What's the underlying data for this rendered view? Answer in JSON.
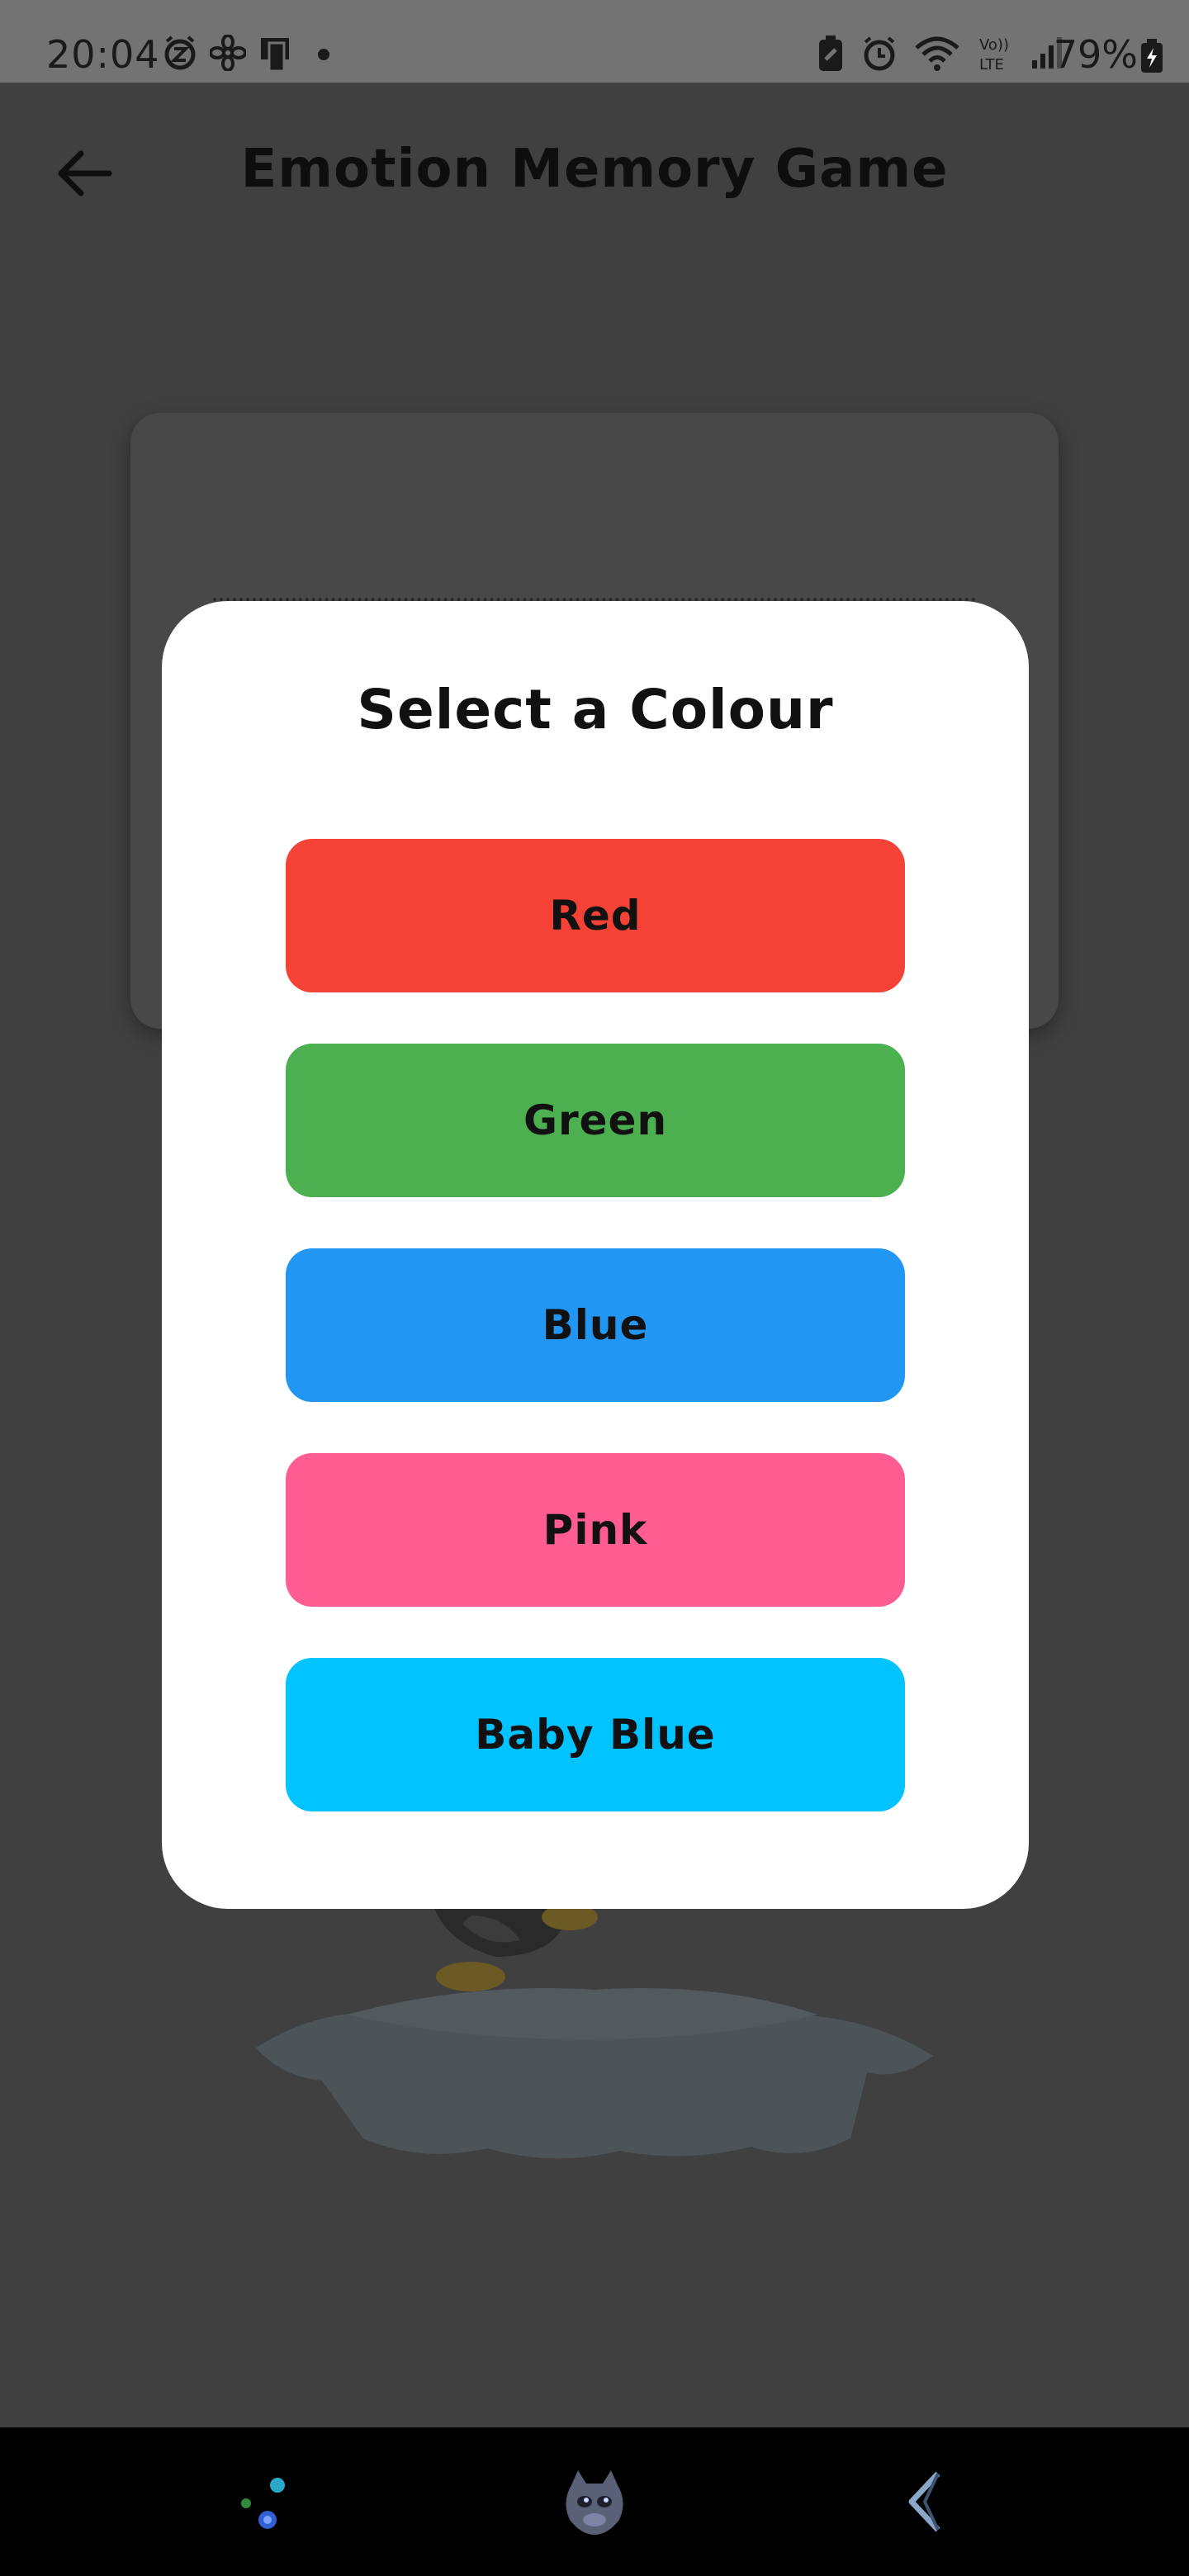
{
  "status_bar": {
    "time": "20:04",
    "battery_percent": "79%",
    "left_icons": [
      "alarm-z-icon",
      "fan-icon",
      "screen-cast-icon",
      "dot-icon"
    ],
    "right_icons": [
      "battery-saver-icon",
      "alarm-icon",
      "wifi-icon",
      "volte-icon",
      "signal-icon"
    ]
  },
  "app_bar": {
    "title": "Emotion Memory Game",
    "back_icon": "arrow-left-icon"
  },
  "dialog": {
    "title": "Select a Colour",
    "options": [
      {
        "label": "Red",
        "color": "#f44336"
      },
      {
        "label": "Green",
        "color": "#4caf50"
      },
      {
        "label": "Blue",
        "color": "#2196f3"
      },
      {
        "label": "Pink",
        "color": "#ff5c92"
      },
      {
        "label": "Baby Blue",
        "color": "#00c3ff"
      }
    ]
  },
  "colors": {
    "scrim": "#404040",
    "status_bar": "#737373",
    "dialog_background": "#ffffff",
    "nav_bar": "#000000"
  },
  "bottom_nav": {
    "items": [
      "sparkle-dots-icon",
      "dragon-mascot-icon",
      "back-arrow-icon"
    ]
  }
}
